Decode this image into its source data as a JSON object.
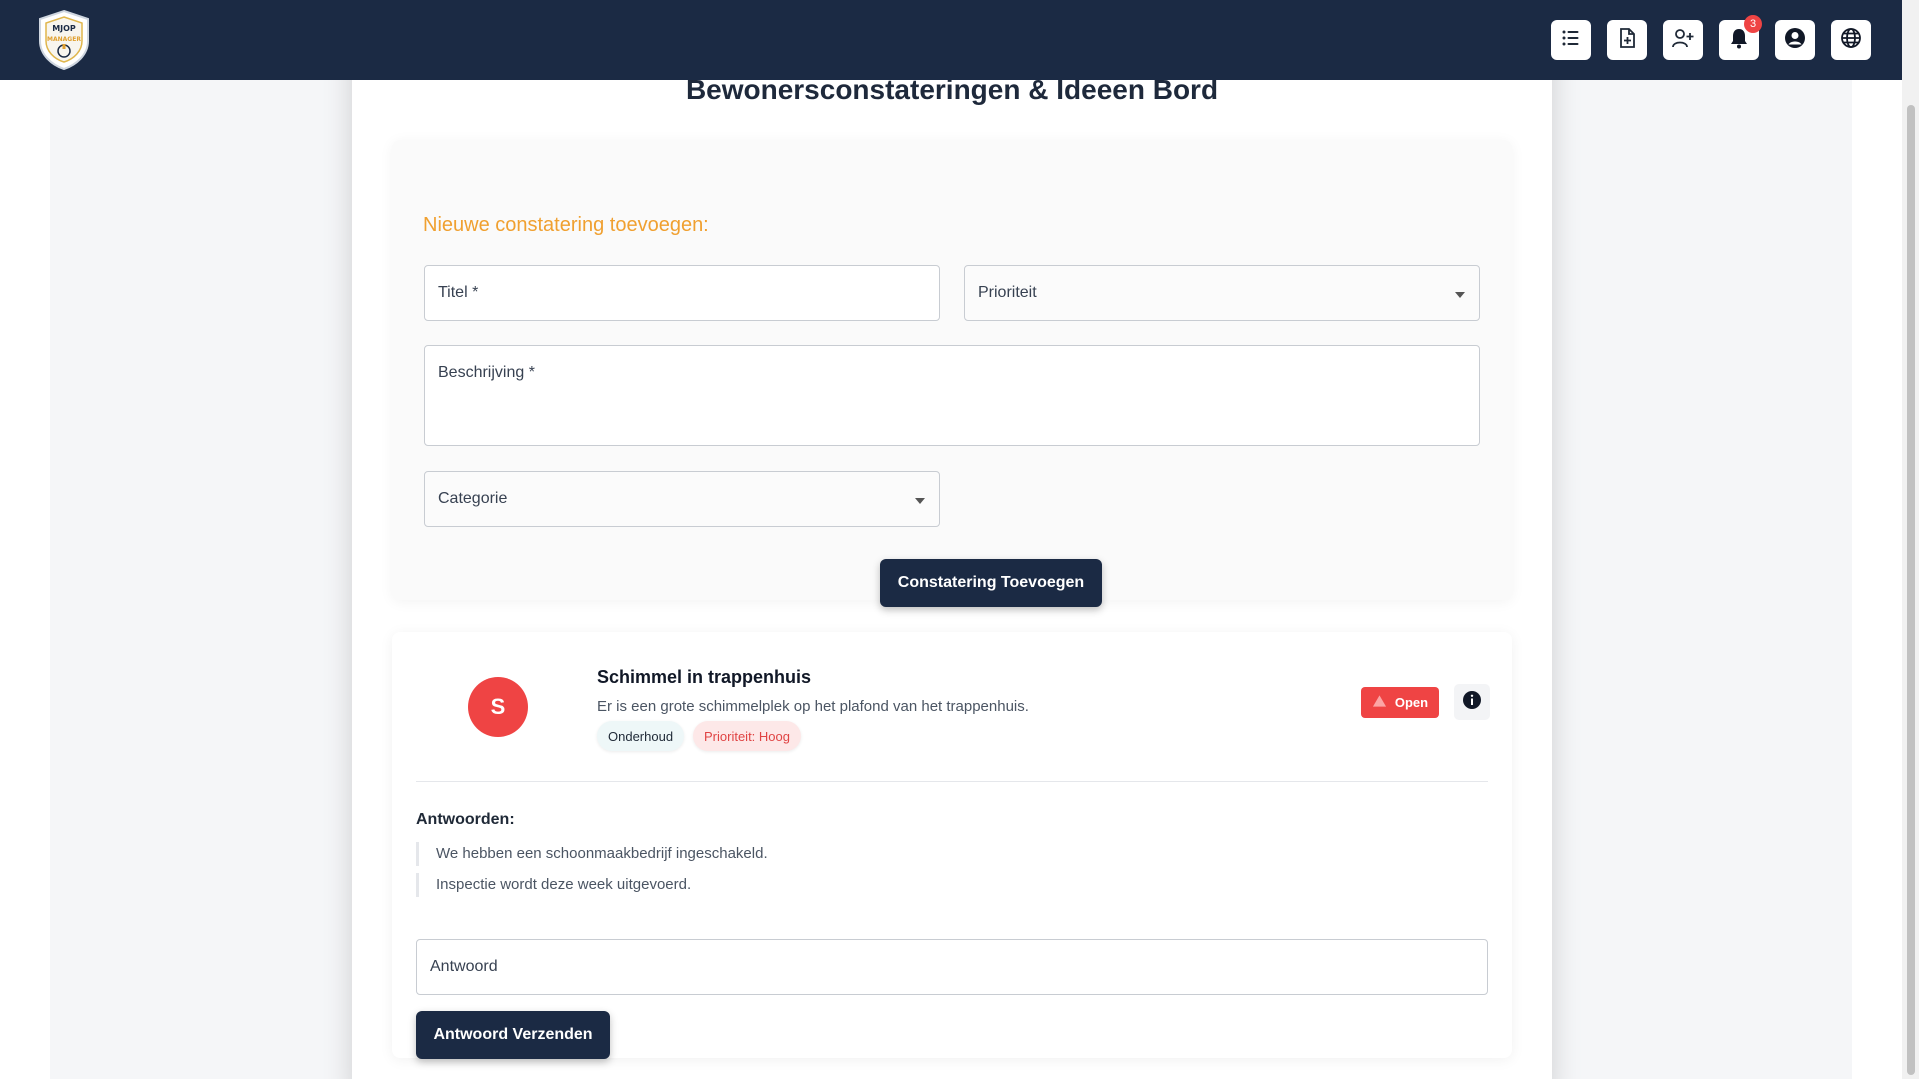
{
  "app": {
    "logo_text_top": "MJOP",
    "logo_text_bottom": "MANAGER",
    "notification_count": "3",
    "icons": [
      "list-icon",
      "file-plus-icon",
      "user-plus-icon",
      "bell-icon",
      "account-icon",
      "globe-icon"
    ]
  },
  "page": {
    "title": "Bewonersconstateringen & Ideeen Bord"
  },
  "form": {
    "heading": "Nieuwe constatering toevoegen:",
    "title_label": "Titel *",
    "priority_label": "Prioriteit",
    "description_label": "Beschrijving *",
    "category_label": "Categorie",
    "submit_label": "Constatering Toevoegen"
  },
  "item": {
    "avatar_letter": "S",
    "title": "Schimmel in trappenhuis",
    "description": "Er is een grote schimmelplek op het plafond van het trappenhuis.",
    "category_tag": "Onderhoud",
    "priority_tag": "Prioriteit: Hoog",
    "status": "Open",
    "answers_heading": "Antwoorden:",
    "answers": [
      "We hebben een schoonmaakbedrijf ingeschakeld.",
      "Inspectie wordt deze week uitgevoerd."
    ],
    "reply_label": "Antwoord",
    "reply_button": "Antwoord Verzenden"
  },
  "colors": {
    "header": "#1b2a44",
    "accent": "#f0a030",
    "status_open": "#ef4444"
  }
}
